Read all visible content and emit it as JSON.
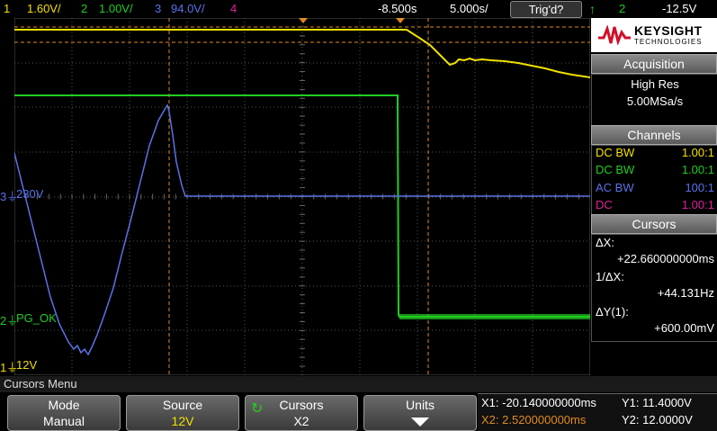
{
  "top_bar": {
    "ch1_num": "1",
    "ch1_scale": "1.60V/",
    "ch2_num": "2",
    "ch2_scale": "1.00V/",
    "ch3_num": "3",
    "ch3_scale": "94.0V/",
    "ch4_num": "4",
    "time_delay": "-8.500s",
    "time_scale": "5.000s/",
    "trigger_status": "Trig'd?",
    "trigger_source": "2",
    "trigger_level": "-12.5V"
  },
  "colors": {
    "ch1": "#f0e000",
    "ch2": "#22cc22",
    "ch3": "#5a72e8",
    "ch4": "#e0209a",
    "cursor": "#e08a20"
  },
  "brand": {
    "name": "KEYSIGHT",
    "sub": "TECHNOLOGIES"
  },
  "acquisition": {
    "title": "Acquisition",
    "mode": "High Res",
    "rate": "5.00MSa/s"
  },
  "channels": {
    "title": "Channels",
    "rows": [
      {
        "coupling": "DC BW",
        "probe": "1.00:1"
      },
      {
        "coupling": "DC BW",
        "probe": "1.00:1"
      },
      {
        "coupling": "AC BW",
        "probe": "100:1"
      },
      {
        "coupling": "DC",
        "probe": "1.00:1"
      }
    ]
  },
  "cursors_panel": {
    "title": "Cursors",
    "dx_label": "ΔX:",
    "dx_value": "+22.660000000ms",
    "inv_label": "1/ΔX:",
    "inv_value": "+44.131Hz",
    "dy_label": "ΔY(1):",
    "dy_value": "+600.00mV"
  },
  "waveform_labels": {
    "ch3": "230V",
    "ch2": "PG_OK",
    "ch1": "12V",
    "ch3_num": "3",
    "ch2_num": "2",
    "ch1_num": "1"
  },
  "menu_title": "Cursors Menu",
  "softkeys": [
    {
      "label": "Mode",
      "value": "Manual"
    },
    {
      "label": "Source",
      "value": "12V"
    },
    {
      "label": "Cursors",
      "value": "X2"
    },
    {
      "label": "Units",
      "value": ""
    }
  ],
  "readout": {
    "x1": "X1: -20.140000000ms",
    "y1": "Y1: 11.4000V",
    "x2": "X2: 2.520000000ms",
    "y2": "Y2: 12.0000V"
  }
}
